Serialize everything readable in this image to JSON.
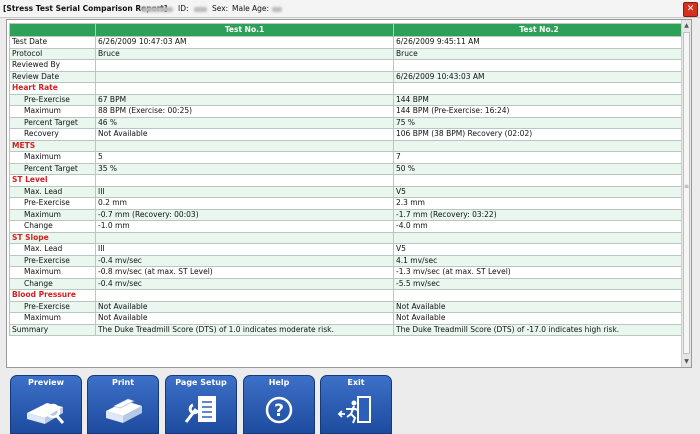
{
  "window": {
    "title": "[Stress Test Serial Comparison Report]",
    "id_label": "ID:",
    "sex_label": "Sex:",
    "sex_value": "Male",
    "age_label": "Age:",
    "close_label": "✕"
  },
  "table": {
    "headers": [
      "",
      "Test No.1",
      "Test No.2"
    ],
    "rows": [
      {
        "kind": "field",
        "label": "Test Date",
        "v1": "6/26/2009 10:47:03 AM",
        "v2": "6/26/2009 9:45:11 AM"
      },
      {
        "kind": "field",
        "label": "Protocol",
        "v1": "Bruce",
        "v2": "Bruce"
      },
      {
        "kind": "field",
        "label": "Reviewed By",
        "v1": "",
        "v2": ""
      },
      {
        "kind": "field",
        "label": "Review Date",
        "v1": "",
        "v2": "6/26/2009 10:43:03 AM"
      },
      {
        "kind": "section",
        "label": "Heart Rate",
        "v1": "",
        "v2": ""
      },
      {
        "kind": "sub",
        "label": "Pre-Exercise",
        "v1": "67 BPM",
        "v2": "144 BPM"
      },
      {
        "kind": "sub",
        "label": "Maximum",
        "v1": "88 BPM (Exercise: 00:25)",
        "v2": "144 BPM (Pre-Exercise: 16:24)"
      },
      {
        "kind": "sub",
        "label": "Percent Target",
        "v1": "46 %",
        "v2": "75 %"
      },
      {
        "kind": "sub",
        "label": "Recovery",
        "v1": "Not Available",
        "v2": "106 BPM (38 BPM) Recovery (02:02)"
      },
      {
        "kind": "section",
        "label": "METS",
        "v1": "",
        "v2": ""
      },
      {
        "kind": "sub",
        "label": "Maximum",
        "v1": "5",
        "v2": "7"
      },
      {
        "kind": "sub",
        "label": "Percent Target",
        "v1": "35 %",
        "v2": "50 %"
      },
      {
        "kind": "section",
        "label": "ST Level",
        "v1": "",
        "v2": ""
      },
      {
        "kind": "sub",
        "label": "Max. Lead",
        "v1": "III",
        "v2": "V5"
      },
      {
        "kind": "sub",
        "label": "Pre-Exercise",
        "v1": "0.2 mm",
        "v2": "2.3 mm"
      },
      {
        "kind": "sub",
        "label": "Maximum",
        "v1": "-0.7 mm (Recovery: 00:03)",
        "v2": "-1.7 mm (Recovery: 03:22)"
      },
      {
        "kind": "sub",
        "label": "Change",
        "v1": "-1.0 mm",
        "v2": "-4.0 mm"
      },
      {
        "kind": "section",
        "label": "ST Slope",
        "v1": "",
        "v2": ""
      },
      {
        "kind": "sub",
        "label": "Max. Lead",
        "v1": "III",
        "v2": "V5"
      },
      {
        "kind": "sub",
        "label": "Pre-Exercise",
        "v1": "-0.4 mv/sec",
        "v2": "4.1 mv/sec"
      },
      {
        "kind": "sub",
        "label": "Maximum",
        "v1": "-0.8 mv/sec (at max. ST Level)",
        "v2": "-1.3 mv/sec (at max. ST Level)"
      },
      {
        "kind": "sub",
        "label": "Change",
        "v1": "-0.4 mv/sec",
        "v2": "-5.5 mv/sec"
      },
      {
        "kind": "section",
        "label": "Blood Pressure",
        "v1": "",
        "v2": ""
      },
      {
        "kind": "sub",
        "label": "Pre-Exercise",
        "v1": "Not Available",
        "v2": "Not Available"
      },
      {
        "kind": "sub",
        "label": "Maximum",
        "v1": "Not Available",
        "v2": "Not Available"
      },
      {
        "kind": "field",
        "label": "Summary",
        "v1": "The Duke Treadmill Score (DTS) of 1.0 indicates moderate risk.",
        "v2": "The Duke Treadmill Score (DTS) of -17.0 indicates high risk."
      }
    ]
  },
  "toolbar": {
    "preview": {
      "label": "Preview",
      "icon": "preview-icon"
    },
    "print": {
      "label": "Print",
      "icon": "printer-icon"
    },
    "page_setup": {
      "label": "Page Setup",
      "icon": "page-setup-icon"
    },
    "help": {
      "label": "Help",
      "icon": "help-icon"
    },
    "exit": {
      "label": "Exit",
      "icon": "exit-icon"
    }
  },
  "colors": {
    "header_green": "#2ea05a",
    "section_red": "#d42020",
    "button_blue": "#2b5fb8",
    "alt_row": "#eaf7ee"
  }
}
